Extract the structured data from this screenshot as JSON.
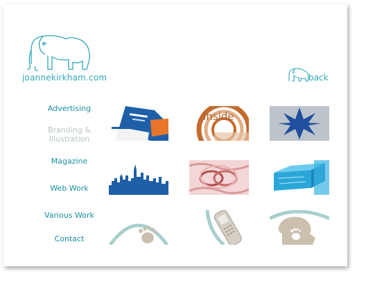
{
  "site": {
    "name": "joannekirkham.com",
    "back_label": "back"
  },
  "nav": {
    "items": [
      {
        "label": "Advertising"
      },
      {
        "label": "Branding &"
      },
      {
        "label": "Illustration"
      },
      {
        "label": "Magazine"
      },
      {
        "label": "Web Work"
      },
      {
        "label": "Various Work"
      },
      {
        "label": "Contact"
      }
    ]
  },
  "thumbnails": {
    "t2_text": "Inside"
  },
  "colors": {
    "accent": "#2fa6b8",
    "nav_active": "#b9c4c9"
  }
}
